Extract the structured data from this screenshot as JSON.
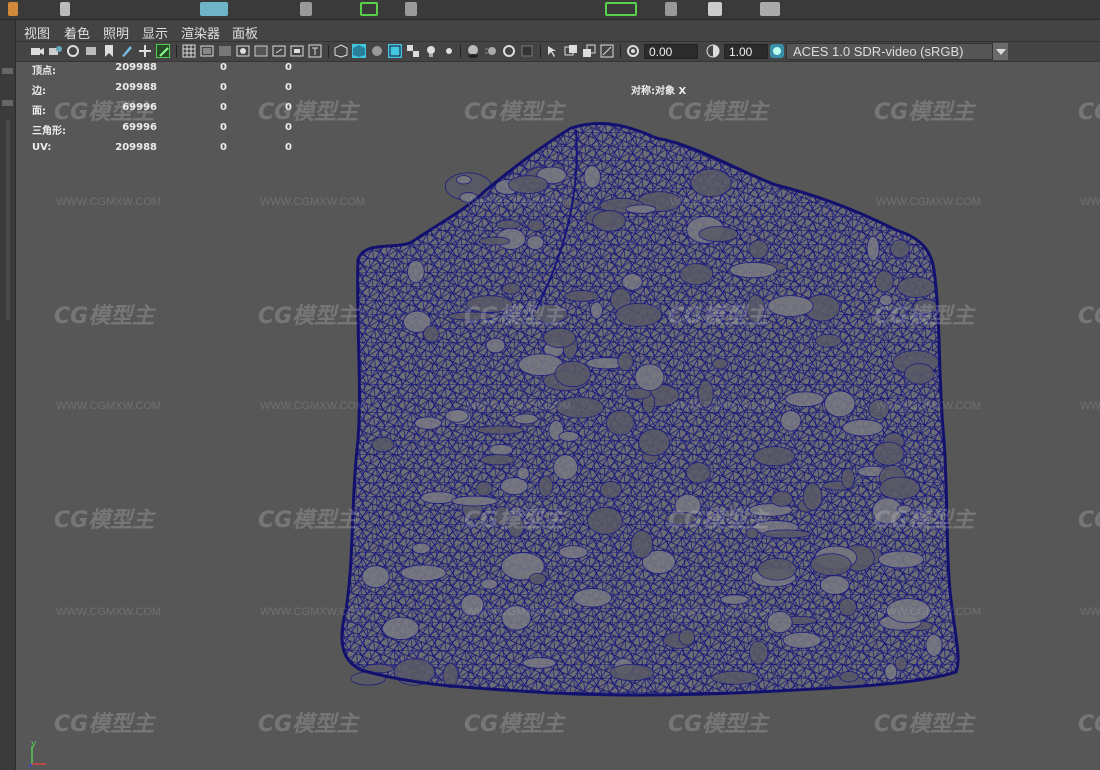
{
  "menu": [
    "视图",
    "着色",
    "照明",
    "显示",
    "渲染器",
    "面板"
  ],
  "toolbar": {
    "camera_near": "0.00",
    "camera_gamma": "1.00",
    "color_space": "ACES 1.0 SDR-video (sRGB)"
  },
  "hud": {
    "rows": [
      {
        "label": "顶点:",
        "a": "209988",
        "b": "0",
        "c": "0"
      },
      {
        "label": "边:",
        "a": "209988",
        "b": "0",
        "c": "0"
      },
      {
        "label": "面:",
        "a": "69996",
        "b": "0",
        "c": "0"
      },
      {
        "label": "三角形:",
        "a": "69996",
        "b": "0",
        "c": "0"
      },
      {
        "label": "UV:",
        "a": "209988",
        "b": "0",
        "c": "0"
      }
    ],
    "symmetry": "对称:对象 X"
  },
  "watermark": {
    "logo": "CG模型主",
    "url": "WWW.CGMXW.COM"
  },
  "axis": {
    "y": "y",
    "x": "x"
  },
  "colors": {
    "wire": "#1a1a7a",
    "mesh_fill": "#6e6e76",
    "viewport_bg": "#575757",
    "accent": "#43c7e0"
  }
}
